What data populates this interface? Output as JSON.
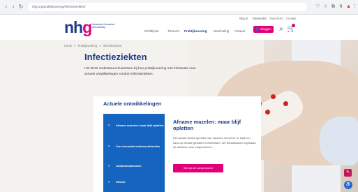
{
  "browser": {
    "back": "‹",
    "forward": "›",
    "reload": "↻",
    "home": "⌂",
    "url": "nhg.org/praktijkvoering/infectieziekten/",
    "ext_icons": [
      "♡",
      "☆",
      "⧉",
      "↯",
      "▲",
      "⋮"
    ]
  },
  "header": {
    "utility": [
      "Nhg.nl",
      "Webwinkel",
      "Over NHG",
      "Contact"
    ],
    "logo_text_a": "nh",
    "logo_text_b": "g",
    "logo_tagline": "Nederlands Huisartsen Genootschap",
    "nav": [
      "Richtlijnen",
      "Thema's",
      "Praktijkvoering",
      "Nascholing",
      "Actueel"
    ],
    "active_nav_index": 2,
    "login_label": "Inloggen",
    "login_icon": "👤",
    "search_icon": "⌕",
    "cart_icon": "🛒",
    "accent": "#e2007a",
    "brand": "#1f3c88"
  },
  "breadcrumb": [
    "Home",
    "Praktijkvoering",
    "Infectieziekten"
  ],
  "breadcrumb_sep": ">",
  "page": {
    "title": "Infectieziekten",
    "intro": "Het NHG ondersteunt huisartsen bij hun praktijkvoering met informatie over actuele ontwikkelingen rondom infectieziekten."
  },
  "panel": {
    "title": "Actuele ontwikkelingen",
    "tabs": [
      "Afname mazelen: maar blijf opletten",
      "Zeer besmette kinkhoestinfecties",
      "Antibioticatekorten",
      "Difterie"
    ],
    "feature_title": "Afname mazelen: maar blijf opletten",
    "feature_text": "Het aantal nieuwe gevallen van mazelen neemt af. Er blijft een kans op nieuwe gevallen in Nederland. We benadrukken nogmaals de adviezen voor zorgverleners.",
    "feature_cta": "Stel zijn de aantal tipseer"
  },
  "floating": {
    "feedback_icon": "✎",
    "accessibility_icon": "♿"
  }
}
